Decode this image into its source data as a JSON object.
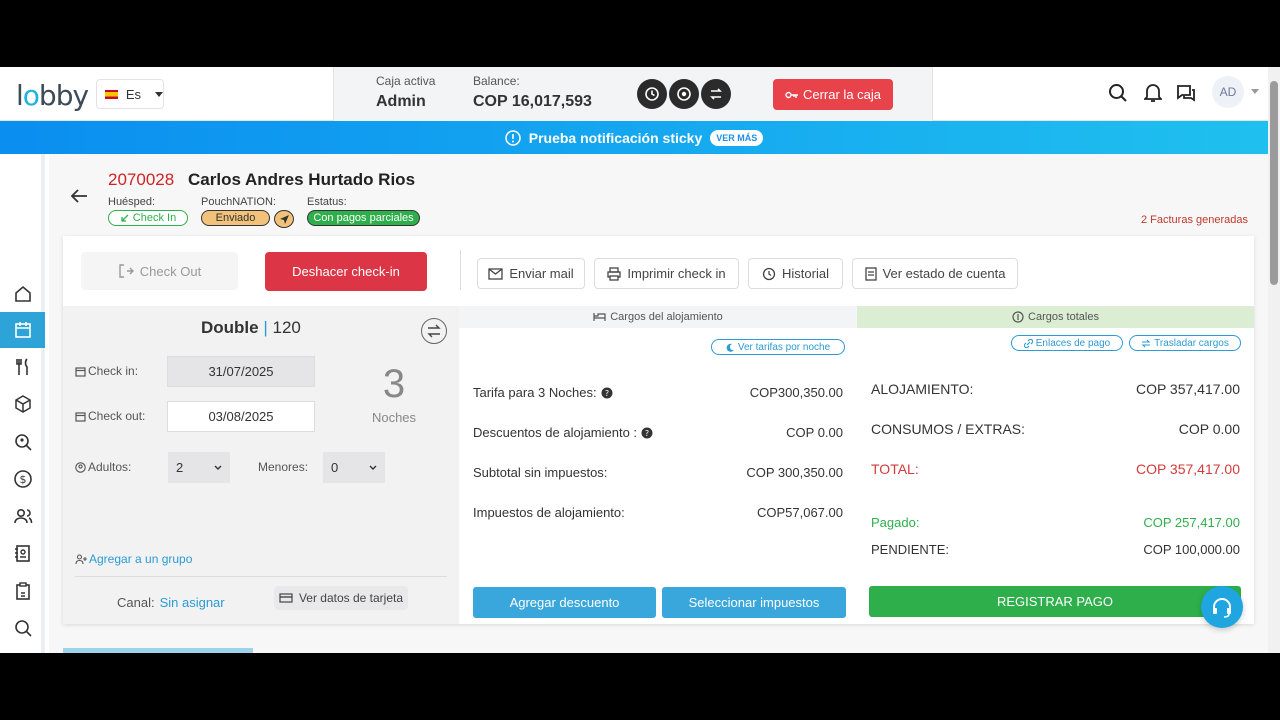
{
  "topbar": {
    "logo": "lobby",
    "language": "Es",
    "caja_label": "Caja activa",
    "caja_value": "Admin",
    "balance_label": "Balance:",
    "balance_value": "COP 16,017,593",
    "cerrar_label": "Cerrar la caja",
    "avatar": "AD"
  },
  "notification": {
    "text": "Prueba notificación sticky",
    "button": "VER MÁS"
  },
  "sidebar": [
    "home-icon",
    "calendar-icon",
    "restaurant-icon",
    "box-icon",
    "search-location-icon",
    "dollar-icon",
    "users-icon",
    "contacts-icon",
    "clipboard-icon",
    "search-icon",
    "chart-icon",
    "clock-icon"
  ],
  "reservation": {
    "number": "2070028",
    "guest_name": "Carlos Andres Hurtado Rios",
    "huesped_label": "Huésped:",
    "huesped_status": "Check In",
    "pouch_label": "PouchNATION:",
    "pouch_status": "Enviado",
    "estatus_label": "Estatus:",
    "estatus_value": "Con pagos parciales",
    "facturas": "2 Facturas generadas"
  },
  "actions": {
    "checkout": "Check Out",
    "deshacer": "Deshacer check-in",
    "enviar_mail": "Enviar mail",
    "imprimir": "Imprimir check in",
    "historial": "Historial",
    "estado_cuenta": "Ver estado de cuenta"
  },
  "room": {
    "type": "Double",
    "number": "120",
    "checkin_label": "Check in:",
    "checkin": "31/07/2025",
    "checkout_label": "Check out:",
    "checkout": "03/08/2025",
    "nights": "3",
    "nights_label": "Noches",
    "adultos_label": "Adultos:",
    "adultos": "2",
    "menores_label": "Menores:",
    "menores": "0",
    "grupo_link": "Agregar a un grupo",
    "canal_label": "Canal:",
    "canal_value": "Sin asignar",
    "tarjeta": "Ver datos de tarjeta"
  },
  "alojamiento": {
    "header": "Cargos del alojamiento",
    "ver_tarifas": "Ver tarifas por noche",
    "rows": [
      {
        "label": "Tarifa para 3 Noches:",
        "value": "COP300,350.00"
      },
      {
        "label": "Descuentos de alojamiento :",
        "value": "COP 0.00"
      },
      {
        "label": "Subtotal sin impuestos:",
        "value": "COP 300,350.00"
      },
      {
        "label": "Impuestos de alojamiento:",
        "value": "COP57,067.00"
      }
    ],
    "agregar_descuento": "Agregar descuento",
    "seleccionar_impuestos": "Seleccionar impuestos"
  },
  "totales": {
    "header": "Cargos totales",
    "enlaces": "Enlaces de pago",
    "trasladar": "Trasladar cargos",
    "alojamiento_label": "ALOJAMIENTO:",
    "alojamiento_value": "COP 357,417.00",
    "consumos_label": "CONSUMOS / EXTRAS:",
    "consumos_value": "COP 0.00",
    "total_label": "TOTAL:",
    "total_value": "COP 357,417.00",
    "pagado_label": "Pagado:",
    "pagado_value": "COP 257,417.00",
    "pendiente_label": "PENDIENTE:",
    "pendiente_value": "COP 100,000.00",
    "registrar": "REGISTRAR PAGO"
  },
  "colors": {
    "accent": "#2ea3d7",
    "danger": "#e8424a",
    "success": "#2eaf4b",
    "total_red": "#d23b3b",
    "pagado_green": "#2eaf4b"
  }
}
